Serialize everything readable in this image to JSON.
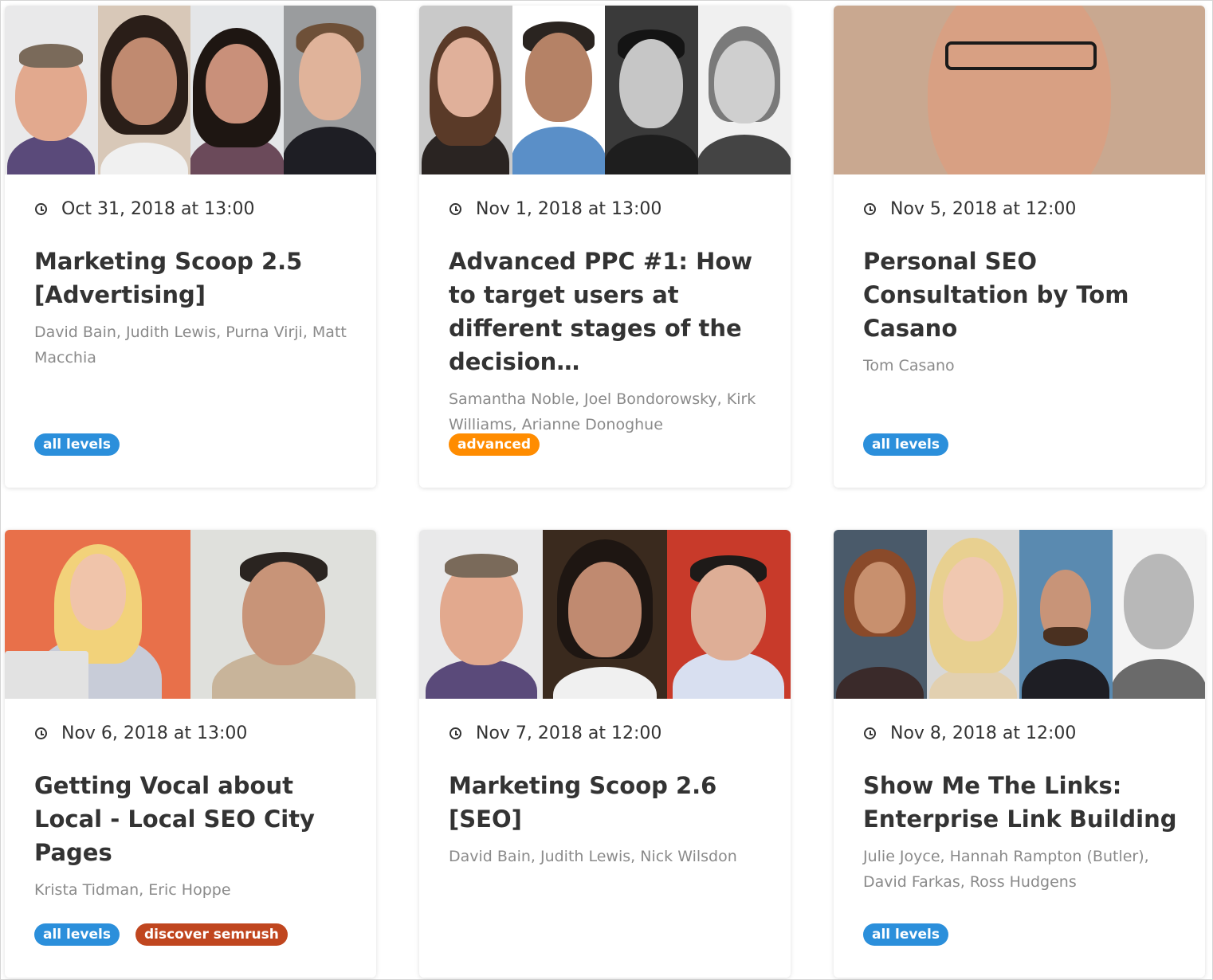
{
  "colors": {
    "all_levels": "#2b8fdb",
    "advanced": "#ff8c00",
    "discover_semrush": "#c0461f"
  },
  "cards": [
    {
      "date": "Oct 31, 2018 at 13:00",
      "title": "Marketing Scoop 2.5 [Advertising]",
      "speakers": "David Bain, Judith Lewis, Purna Virji, Matt Macchia",
      "tags": [
        "all levels"
      ]
    },
    {
      "date": "Nov 1, 2018 at 13:00",
      "title": "Advanced PPC #1: How to target users at different stages of the decision…",
      "speakers": "Samantha Noble, Joel Bondorowsky, Kirk Williams, Arianne Donoghue",
      "tags": [
        "advanced"
      ]
    },
    {
      "date": "Nov 5, 2018 at 12:00",
      "title": "Personal SEO Consultation by Tom Casano",
      "speakers": "Tom Casano",
      "tags": [
        "all levels"
      ]
    },
    {
      "date": "Nov 6, 2018 at 13:00",
      "title": "Getting Vocal about Local - Local SEO City Pages",
      "speakers": "Krista Tidman, Eric Hoppe",
      "tags": [
        "all levels",
        "discover semrush"
      ]
    },
    {
      "date": "Nov 7, 2018 at 12:00",
      "title": "Marketing Scoop 2.6 [SEO]",
      "speakers": "David Bain, Judith Lewis, Nick Wilsdon",
      "tags": []
    },
    {
      "date": "Nov 8, 2018 at 12:00",
      "title": "Show Me The Links: Enterprise Link Building",
      "speakers": "Julie Joyce, Hannah Rampton (Butler), David Farkas, Ross Hudgens",
      "tags": [
        "all levels"
      ]
    }
  ]
}
